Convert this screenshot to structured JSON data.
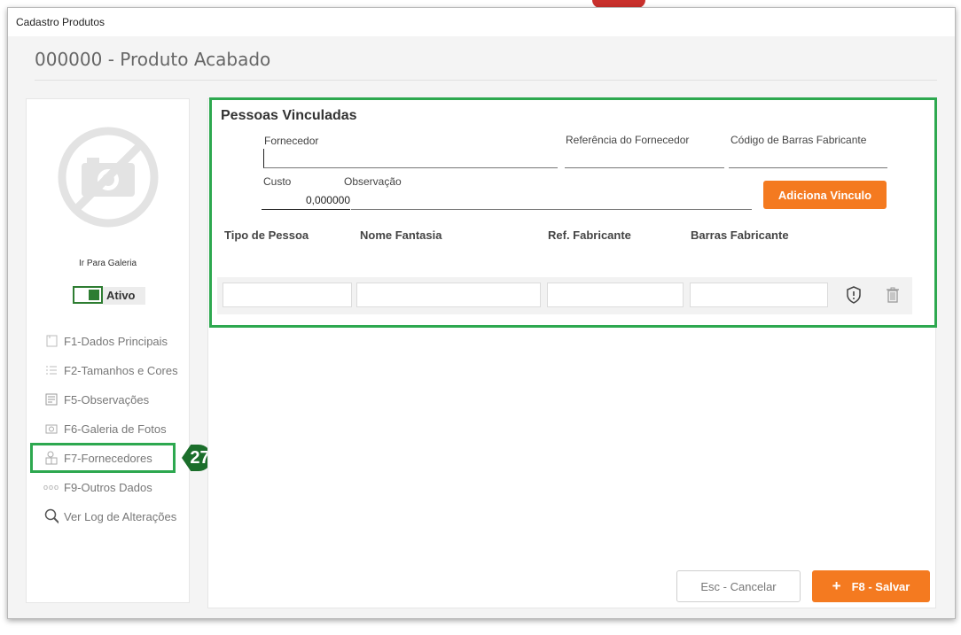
{
  "window": {
    "title": "Cadastro Produtos"
  },
  "header": {
    "page_title": "000000 - Produto Acabado"
  },
  "sidebar": {
    "gallery_link": "Ir Para Galeria",
    "toggle_label": "Ativo",
    "toggle_on": true,
    "items": [
      {
        "label": "F1-Dados Principais",
        "icon": "document-icon"
      },
      {
        "label": "F2-Tamanhos  e Cores",
        "icon": "list-icon"
      },
      {
        "label": "F5-Observações",
        "icon": "notes-icon"
      },
      {
        "label": "F6-Galeria de Fotos",
        "icon": "camera-icon"
      },
      {
        "label": "F7-Fornecedores",
        "icon": "supplier-icon"
      },
      {
        "label": "F9-Outros Dados",
        "icon": "more-icon"
      },
      {
        "label": "Ver Log de Alterações",
        "icon": "search-icon"
      }
    ],
    "step_badge": "27"
  },
  "section": {
    "title": "Pessoas Vinculadas",
    "fornecedor_label": "Fornecedor",
    "fornecedor_value": "",
    "ref_fornecedor_label": "Referência do Fornecedor",
    "ref_fornecedor_value": "",
    "codigo_barras_label": "Código de Barras Fabricante",
    "codigo_barras_value": "",
    "custo_label": "Custo",
    "custo_value": "0,000000",
    "observacao_label": "Observação",
    "observacao_value": "",
    "add_button": "Adiciona Vinculo",
    "table": {
      "headers": [
        "Tipo de Pessoa",
        "Nome Fantasia",
        "Ref. Fabricante",
        "Barras Fabricante"
      ],
      "rows": [
        [
          "",
          "",
          "",
          ""
        ]
      ]
    }
  },
  "footer": {
    "cancel_label": "Esc - Cancelar",
    "save_label": "F8 - Salvar",
    "save_icon": "+"
  },
  "colors": {
    "accent": "#f47a20",
    "highlight": "#2da84f",
    "badge": "#1b6e2b"
  }
}
